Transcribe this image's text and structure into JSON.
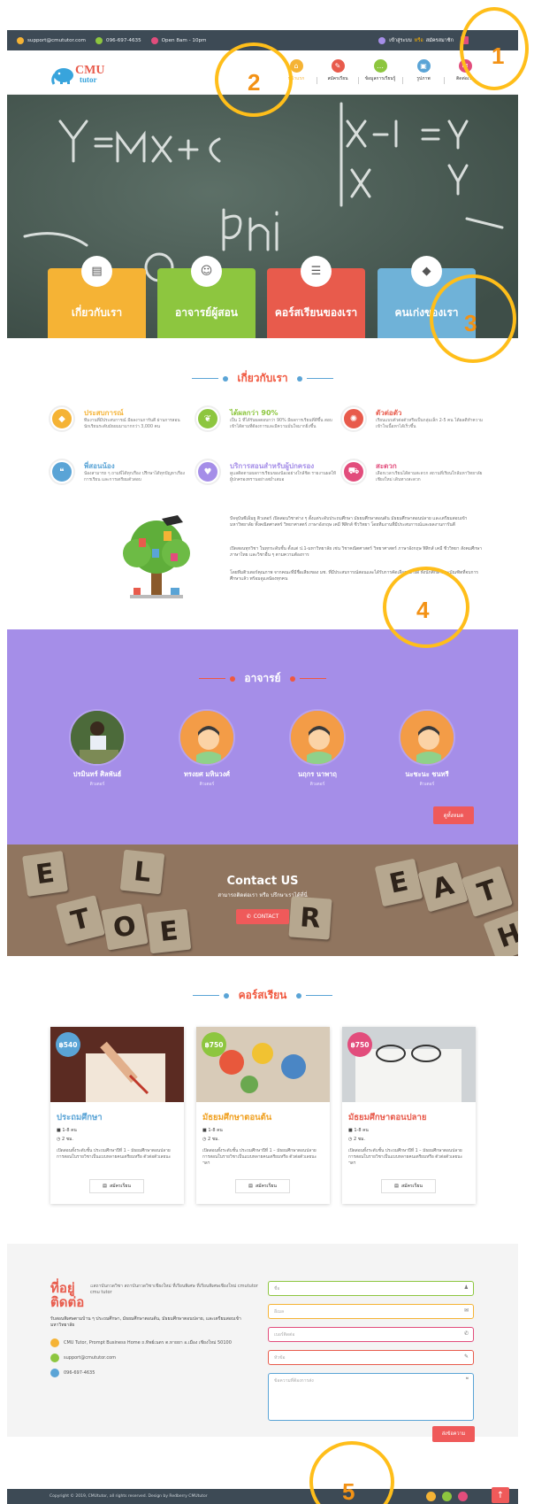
{
  "topbar": {
    "email": "support@cmututor.com",
    "phone": "096-697-4635",
    "hours": "Open 8am - 10pm",
    "login": "เข้าสู่ระบบ",
    "or": "หรือ",
    "register": "สมัครสมาชิก"
  },
  "nav": {
    "logo_main": "CMU",
    "logo_sub": "tutor",
    "items": [
      {
        "label": "หน้าแรก",
        "icon": "home-icon",
        "color": "#f5b335"
      },
      {
        "label": "สมัครเรียน",
        "icon": "pencil-icon",
        "color": "#e85b4c"
      },
      {
        "label": "ข้อมูลการเรียนรู้",
        "icon": "chat-icon",
        "color": "#8dc63f"
      },
      {
        "label": "รูปภาพ",
        "icon": "image-icon",
        "color": "#5aa4d6"
      },
      {
        "label": "ติดต่อเรา",
        "icon": "mail-icon",
        "color": "#e24d7c"
      }
    ]
  },
  "hero": {
    "boxes": [
      {
        "label": "เกี่ยวกับเรา",
        "icon": "id-card-icon",
        "color": "#f5b335"
      },
      {
        "label": "อาจารย์ผู้สอน",
        "icon": "user-icon",
        "color": "#8dc63f"
      },
      {
        "label": "คอร์สเรียนของเรา",
        "icon": "list-icon",
        "color": "#e85b4c"
      },
      {
        "label": "คนเก่งของเรา",
        "icon": "graduation-cap-icon",
        "color": "#6fb2d8"
      }
    ]
  },
  "about": {
    "title": "เกี่ยวกับเรา",
    "features": [
      {
        "title": "ประสบการณ์",
        "desc": "ทีมงานที่มีประสบการณ์ มีผลงานการันตี ผ่านการสอนนักเรียนระดับมัธยมมามากกว่า 3,000 คน",
        "color": "#f5b335",
        "icon": "graduation-icon"
      },
      {
        "title": "ได้ผลกว่า 90%",
        "desc": "เป็น 1 ที่ได้รับผลตอบกว่า 90% มีผลการเรียนที่ดีขึ้น สอบเข้าได้ตามที่ต้องการและมีความมั่นใจมากยิ่งขึ้น",
        "color": "#8dc63f",
        "icon": "leaf-icon"
      },
      {
        "title": "ตัวต่อตัว",
        "desc": "เรียนแบบตัวต่อตัวหรือเป็นกลุ่มเล็ก 2-5 คน ได้ผลดีทำความเข้าใจเนื้อหาได้เร็วขึ้น",
        "color": "#e85b4c",
        "icon": "target-icon"
      },
      {
        "title": "พี่สอนน้อง",
        "desc": "น้องสามารถ ๆ ถามพี่ได้ทุกเรื่อง ปรึกษาได้ทุกปัญหาเรื่องการเรียน และการเตรียมตัวสอบ",
        "color": "#5aa4d6",
        "icon": "chat-bubble-icon"
      },
      {
        "title": "บริการสอนสำหรับผู้ปกครอง",
        "desc": "ดูแลติดตามผลการเรียนของน้องอย่างใกล้ชิด รายงานผลให้ผู้ปกครองทราบอย่างสม่ำเสมอ",
        "color": "#a58ee8",
        "icon": "heart-icon"
      },
      {
        "title": "สะดวก",
        "desc": "เลือกเวลาเรียนได้ตามสะดวก สถานที่เรียนใกล้มหาวิทยาลัยเชียงใหม่ เดินทางสะดวก",
        "color": "#e24d7c",
        "icon": "car-icon"
      }
    ],
    "paragraphs": [
      "ปัจจุบันซีเอ็มยู ติวเตอร์ เปิดสอนวิชาต่าง ๆ ตั้งแต่ระดับประถมศึกษา มัธยมศึกษาตอนต้น มัธยมศึกษาตอนปลาย และเตรียมสอบเข้ามหาวิทยาลัย ทั้งคณิตศาสตร์ วิทยาศาสตร์ ภาษาอังกฤษ เคมี ฟิสิกส์ ชีววิทยา โดยทีมงานที่มีประสบการณ์และผลงานการันตี",
      "เปิดสอนทุกวิชา ในทุกระดับชั้น ตั้งแต่ ป.1-มหาวิทยาลัย เช่น วิชาคณิตศาสตร์ วิทยาศาสตร์ ภาษาอังกฤษ ฟิสิกส์ เคมี ชีววิทยา สังคมศึกษา ภาษาไทย และวิชาอื่น ๆ ตามความต้องการ",
      "โดยทีมติวเตอร์คุณภาพ จากคณะที่มีชื่อเสียงของ มช. ที่มีประสบการณ์สอนและได้รับการคัดเลือกอย่างดี ทั้งนักศึกษาและบัณฑิตที่จบการศึกษาแล้ว พร้อมดูแลน้องทุกคน"
    ]
  },
  "teachers": {
    "title": "อาจารย์",
    "list": [
      {
        "name": "ปรมินทร์ ศิลพันธ์",
        "role": "ติวเตอร์",
        "photo": true
      },
      {
        "name": "ทรงยศ มหินวงศ์",
        "role": "ติวเตอร์",
        "photo": false
      },
      {
        "name": "นฤกร นาพาฤ",
        "role": "ติวเตอร์",
        "photo": false
      },
      {
        "name": "นะชะนะ ชนทรี",
        "role": "ติวเตอร์",
        "photo": false
      }
    ],
    "see_all": "ดูทั้งหมด"
  },
  "contact_banner": {
    "title": "Contact US",
    "subtitle": "สามารถติดต่อเรา หรือ ปรึกษาเราได้ที่นี่",
    "button": "CONTACT"
  },
  "courses": {
    "title": "คอร์สเรียน",
    "cards": [
      {
        "price": "฿540",
        "price_color": "#5aa4d6",
        "title": "ประถมศึกษา",
        "sessions": "1-8 คน",
        "hours": "2 ชม.",
        "desc": "เปิดสอนทั้งระดับชั้น ประถมศึกษาปีที่ 1 – มัธยมศึกษาตอนปลาย การสอนในรายวิชาเป็นแบบหลายคนเตรียมหรือ ตัวต่อตัวเลยนะ",
        "button": "สมัครเรียน"
      },
      {
        "price": "฿750",
        "price_color": "#8dc63f",
        "title": "มัธยมศึกษาตอนต้น",
        "sessions": "1-8 คน",
        "hours": "2 ชม.",
        "desc": "เปิดสอนทั้งระดับชั้น ประถมศึกษาปีที่ 1 – มัธยมศึกษาตอนปลาย การสอนในรายวิชาเป็นแบบหลายคนเตรียมหรือ ตัวต่อตัวเลยนะ ฯลฯ",
        "button": "สมัครเรียน"
      },
      {
        "price": "฿750",
        "price_color": "#e24d7c",
        "title": "มัธยมศึกษาตอนปลาย",
        "sessions": "1-8 คน",
        "hours": "2 ชม.",
        "desc": "เปิดสอนทั้งระดับชั้น ประถมศึกษาปีที่ 1 – มัธยมศึกษาตอนปลาย การสอนในรายวิชาเป็นแบบหลายคนเตรียมหรือ ตัวต่อตัวเลยนะ ฯลฯ",
        "button": "สมัครเรียน"
      }
    ]
  },
  "contact": {
    "title1": "ที่อยู่",
    "title2": "ติดต่อ",
    "image_alt": "สถาบันกวดวิชา สถาบันกวดวิชาเชียงใหม่ ที่เรียนพิเศษ ที่เรียนพิเศษเชียงใหม่ cmututor cmu tutor",
    "intro": "รับสอนพิเศษตามบ้าน ๆ ประถมศึกษา, มัธยมศึกษาตอนต้น, มัธยมศึกษาตอนปลาย, และเตรียมสอบเข้ามหาวิทยาลัย",
    "address": "CMU Tutor, Prompt Business Home ถ.ทิพย์เนตร ต.หายยา อ.เมือง เชียงใหม่ 50100",
    "email": "support@cmututor.com",
    "phone": "096-697-4635",
    "form": {
      "name": "ชื่อ",
      "email": "อีเมล",
      "phone": "เบอร์ติดต่อ",
      "subject": "หัวข้อ",
      "message": "ข้อความที่ต้องการส่ง",
      "submit": "ส่งข้อความ"
    }
  },
  "footer": {
    "copyright": "Copyright © 2019, CMUtutor, all rights reserved. Design by Redberry CMUtutor"
  },
  "annotations": [
    "1",
    "2",
    "3",
    "4",
    "5"
  ]
}
